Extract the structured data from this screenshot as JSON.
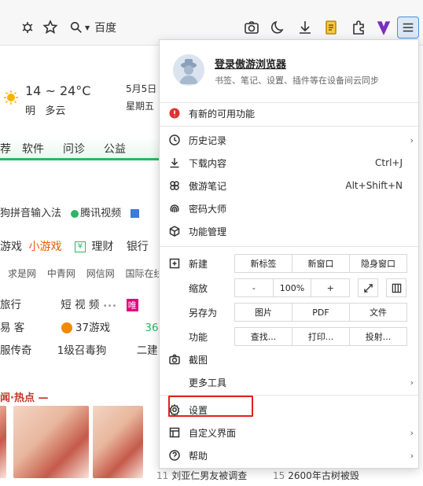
{
  "toolbar": {
    "search_engine": "百度"
  },
  "page": {
    "weather": {
      "temp": "14 ~ 24°C",
      "tomorrow": "明",
      "condition": "多云",
      "date": "5月5日",
      "weekday": "星期五"
    },
    "nav": [
      "荐",
      "软件",
      "问诊",
      "公益"
    ],
    "line1": [
      "狗拼音输入法",
      "腾讯视频"
    ],
    "line2": {
      "a": "游戏",
      "b": "小游戏",
      "c": "理财",
      "d": "银行"
    },
    "line3": [
      "求是网",
      "中青网",
      "网信网",
      "国际在线"
    ],
    "line4": [
      "旅行",
      "短 视 频",
      "唯"
    ],
    "line5": [
      "易 客",
      "37游戏",
      "36"
    ],
    "line6": [
      "服传奇",
      "1级召毒狗",
      "二建"
    ],
    "hot": "闻·热点 —",
    "bottom": [
      {
        "num": "11",
        "text": "刘亚仁男友被调查"
      },
      {
        "num": "15",
        "text": "2600年古树被毁"
      }
    ]
  },
  "menu": {
    "profile_title": "登录傲游浏览器",
    "profile_sub": "书签、笔记、设置、插件等在设备间云同步",
    "new_feature": "有新的可用功能",
    "history": "历史记录",
    "downloads": "下载内容",
    "downloads_shortcut": "Ctrl+J",
    "notes": "傲游笔记",
    "notes_shortcut": "Alt+Shift+N",
    "passwords": "密码大师",
    "features": "功能管理",
    "new": "新建",
    "new_buttons": [
      "新标签",
      "新窗口",
      "隐身窗口"
    ],
    "zoom": "缩放",
    "zoom_minus": "-",
    "zoom_value": "100%",
    "zoom_plus": "+",
    "save_as": "另存为",
    "save_buttons": [
      "图片",
      "PDF",
      "文件"
    ],
    "func": "功能",
    "func_buttons": [
      "查找...",
      "打印...",
      "投射..."
    ],
    "screenshot": "截图",
    "more_tools": "更多工具",
    "settings": "设置",
    "customize": "自定义界面",
    "help": "帮助"
  }
}
